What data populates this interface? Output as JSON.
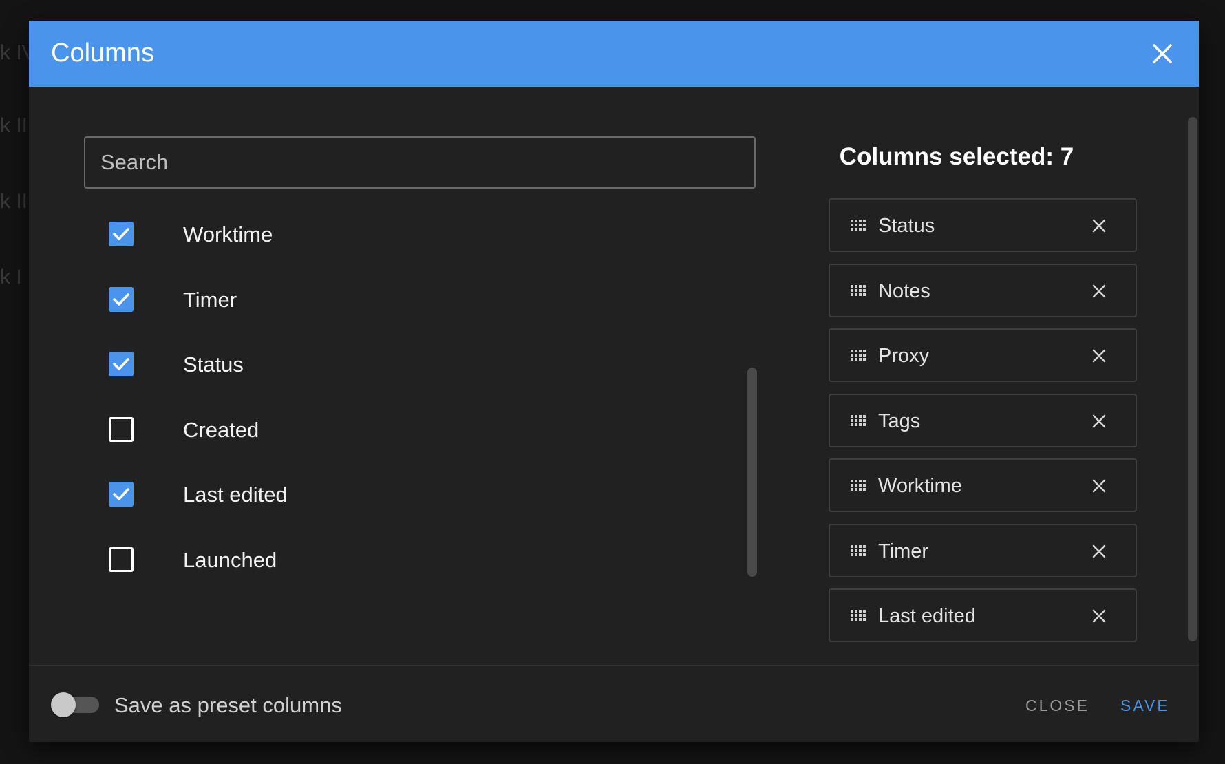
{
  "dialog": {
    "title": "Columns",
    "search_placeholder": "Search",
    "selected_heading": "Columns selected: 7",
    "options": [
      {
        "label": "Worktime",
        "checked": true
      },
      {
        "label": "Timer",
        "checked": true
      },
      {
        "label": "Status",
        "checked": true
      },
      {
        "label": "Created",
        "checked": false
      },
      {
        "label": "Last edited",
        "checked": true
      },
      {
        "label": "Launched",
        "checked": false
      }
    ],
    "selected": [
      {
        "label": "Status"
      },
      {
        "label": "Notes"
      },
      {
        "label": "Proxy"
      },
      {
        "label": "Tags"
      },
      {
        "label": "Worktime"
      },
      {
        "label": "Timer"
      },
      {
        "label": "Last edited"
      }
    ],
    "preset_label": "Save as preset columns",
    "preset_enabled": false,
    "close_label": "CLOSE",
    "save_label": "SAVE"
  },
  "colors": {
    "accent": "#4a94ec",
    "dialog_bg": "#212121"
  }
}
